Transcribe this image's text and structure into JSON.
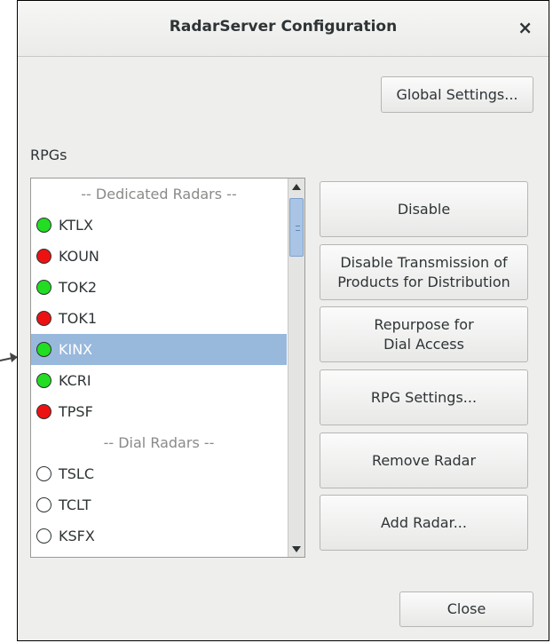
{
  "window": {
    "title": "RadarServer Configuration",
    "close_glyph": "×"
  },
  "global_settings_label": "Global Settings...",
  "rpgs_label": "RPGs",
  "list": {
    "dedicated_header": "-- Dedicated Radars --",
    "dial_header": "-- Dial Radars --",
    "dedicated": [
      {
        "name": "KTLX",
        "status": "green"
      },
      {
        "name": "KOUN",
        "status": "red"
      },
      {
        "name": "TOK2",
        "status": "green"
      },
      {
        "name": "TOK1",
        "status": "red"
      },
      {
        "name": "KINX",
        "status": "green"
      },
      {
        "name": "KCRI",
        "status": "green"
      },
      {
        "name": "TPSF",
        "status": "red"
      }
    ],
    "dial": [
      {
        "name": "TSLC",
        "status": "empty"
      },
      {
        "name": "TCLT",
        "status": "empty"
      },
      {
        "name": "KSFX",
        "status": "empty"
      }
    ],
    "selected": "KINX"
  },
  "buttons": {
    "disable": "Disable",
    "disable_transmission": [
      "Disable Transmission of",
      "Products for Distribution"
    ],
    "repurpose": [
      "Repurpose for",
      "Dial Access"
    ],
    "rpg_settings": "RPG Settings...",
    "remove_radar": "Remove Radar",
    "add_radar": "Add Radar...",
    "close": "Close"
  },
  "colors": {
    "green": "#22dd22",
    "red": "#ee1111",
    "empty": "#ffffff",
    "selection": "#98b8dc"
  }
}
